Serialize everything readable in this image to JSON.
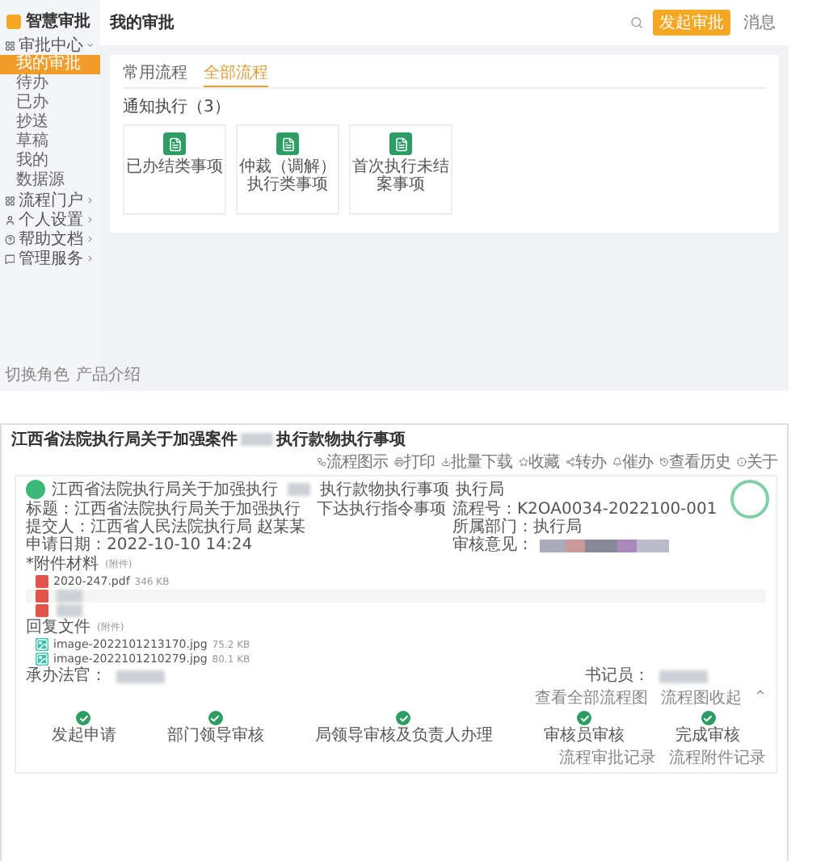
{
  "app": {
    "logo": "智慧审批",
    "sidebar": {
      "groups": [
        {
          "label": "审批中心",
          "expanded": true,
          "children": [
            {
              "label": "我的审批",
              "selected": true
            },
            {
              "label": "待办",
              "selected": false
            },
            {
              "label": "已办",
              "selected": false
            },
            {
              "label": "抄送",
              "selected": false
            },
            {
              "label": "草稿",
              "selected": false
            },
            {
              "label": "我的",
              "selected": false
            },
            {
              "label": "数据源",
              "selected": false
            }
          ]
        },
        {
          "label": "流程门户",
          "expanded": false
        },
        {
          "label": "个人设置",
          "expanded": false
        },
        {
          "label": "帮助文档",
          "expanded": false
        },
        {
          "label": "管理服务",
          "expanded": false
        }
      ],
      "footer": [
        "切换角色",
        "产品介绍"
      ]
    },
    "header": {
      "title": "我的审批",
      "primary_button": "发起审批",
      "secondary_button": "消息"
    },
    "tabs": [
      {
        "label": "常用流程",
        "selected": false
      },
      {
        "label": "全部流程",
        "selected": true
      }
    ],
    "section": {
      "title": "通知执行（3）",
      "cards": [
        "已办结类事项",
        "仲裁（调解）执行类事项",
        "首次执行未结案事项"
      ]
    }
  },
  "detail": {
    "title_start": "江西省法院执行局关于加强案件",
    "title_end": "执行款物执行事项",
    "toolbar": [
      "流程图示",
      "打印",
      "批量下载",
      "收藏",
      "转办",
      "催办",
      "查看历史",
      "关于"
    ],
    "summary": {
      "line_start": "江西省法院执行局关于加强执行",
      "line_end": "执行款物执行事项",
      "department": "执行局"
    },
    "fields_left": [
      "标题：江西省法院执行局关于加强执行　下达执行指令事项",
      "提交人：江西省人民法院执行局 赵某某",
      "申请日期：2022-10-10 14:24"
    ],
    "fields_right": [
      "流程号：K2OA0034-2022100-001",
      "所属部门：执行局",
      "审核意见："
    ],
    "attachments": {
      "title": "*附件材料",
      "hint": "(附件)",
      "files": [
        {
          "name": "2020-247.pdf",
          "size": "346 KB",
          "blurred": false
        },
        {
          "blurred": true
        },
        {
          "blurred": true
        }
      ]
    },
    "replies": {
      "title": "回复文件",
      "hint": "(附件)",
      "files": [
        {
          "name": "image-2022101213170.jpg",
          "size": "75.2 KB"
        },
        {
          "name": "image-2022101210279.jpg",
          "size": "80.1 KB"
        }
      ]
    },
    "people": [
      "承办法官：",
      "书记员："
    ],
    "links": [
      "查看全部流程图",
      "流程图收起"
    ],
    "steps": [
      {
        "label": "发起申请",
        "done": true
      },
      {
        "label": "部门领导审核",
        "done": true
      },
      {
        "label": "局领导审核及负责人办理",
        "done": true
      },
      {
        "label": "审核员审核",
        "done": true
      },
      {
        "label": "完成审核",
        "done": true
      }
    ],
    "footer_links": [
      "流程审批记录",
      "流程附件记录"
    ]
  }
}
